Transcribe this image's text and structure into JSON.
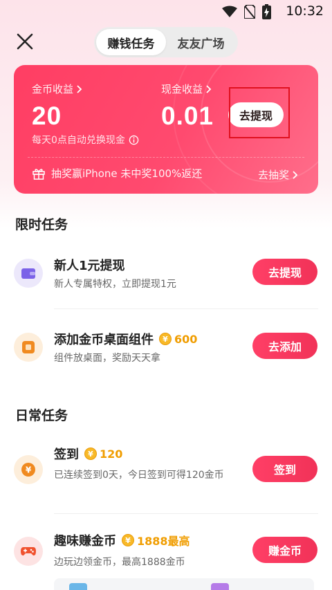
{
  "status_bar": {
    "time": "10:32"
  },
  "tabs": [
    {
      "label": "赚钱任务",
      "active": true
    },
    {
      "label": "友友广场",
      "active": false
    }
  ],
  "earnings": {
    "coin_label": "金币收益",
    "coin_value": "20",
    "cash_label": "现金收益",
    "cash_value": "0.01",
    "withdraw_button": "去提现",
    "auto_exchange_note": "每天0点自动兑换现金",
    "lottery_text": "抽奖赢iPhone 未中奖100%返还",
    "lottery_link": "去抽奖"
  },
  "limited_section": {
    "title": "限时任务",
    "tasks": [
      {
        "name": "新人1元提现",
        "desc": "新人专属特权，立即提现1元",
        "button": "去提现",
        "reward": ""
      },
      {
        "name": "添加金币桌面组件",
        "desc": "组件放桌面，奖励天天拿",
        "button": "去添加",
        "reward": "600"
      }
    ]
  },
  "daily_section": {
    "title": "日常任务",
    "tasks": [
      {
        "name": "签到",
        "desc": "已连续签到0天，今日签到可得120金币",
        "button": "签到",
        "reward": "120"
      },
      {
        "name": "趣味赚金币",
        "desc": "边玩边领金币，最高1888金币",
        "button": "赚金币",
        "reward": "1888最高"
      }
    ]
  },
  "colors": {
    "accent": "#ff3f66",
    "reward": "#f09d00",
    "card_start": "#ff3e63",
    "card_end": "#ff6e8b"
  },
  "icons": [
    "wifi-icon",
    "no-sim-icon",
    "battery-charging-icon",
    "close-icon",
    "chevron-right-icon",
    "info-icon",
    "gift-icon",
    "wallet-icon",
    "widget-icon",
    "yuan-coin-icon",
    "gamepad-icon"
  ]
}
